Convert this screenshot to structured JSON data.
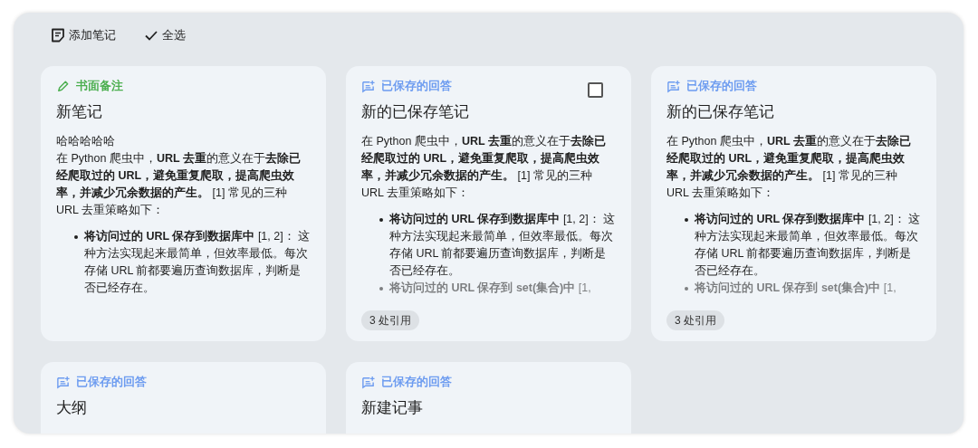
{
  "toolbar": [
    {
      "kind": "add",
      "label": "添加笔记"
    },
    {
      "kind": "select_all",
      "label": "全选"
    }
  ],
  "notes": [
    {
      "source": {
        "kind": "written",
        "label": "书面备注"
      },
      "title": "新笔记",
      "lines": [
        "哈哈哈哈哈",
        "在 Python 爬虫中，**URL 去重**的意义在于**去除已经爬取过的 URL，避免重复爬取，提高爬虫效率，并减少冗余数据的产生。** [1] 常见的三种 URL 去重策略如下："
      ],
      "bullets": [
        "**将访问过的 URL 保存到数据库中** [1, 2]： 这种方法实现起来最简单，但效率最低。每次存储 URL 前都要遍历查询数据库，判断是否已经存在。"
      ]
    },
    {
      "source": {
        "kind": "saved",
        "label": "已保存的回答"
      },
      "title": "新的已保存笔记",
      "checkbox": {
        "checked": false
      },
      "lines": [
        "在 Python 爬虫中，**URL 去重**的意义在于**去除已经爬取过的 URL，避免重复爬取，提高爬虫效率，并减少冗余数据的产生。** [1] 常见的三种 URL 去重策略如下："
      ],
      "bullets": [
        "**将访问过的 URL 保存到数据库中** [1, 2]： 这种方法实现起来最简单，但效率最低。每次存储 URL 前都要遍历查询数据库，判断是否已经存在。",
        "**将访问过的 URL 保存到 set(集合)中** [1,"
      ],
      "citations": "3 处引用"
    },
    {
      "source": {
        "kind": "saved",
        "label": "已保存的回答"
      },
      "title": "新的已保存笔记",
      "lines": [
        "在 Python 爬虫中，**URL 去重**的意义在于**去除已经爬取过的 URL，避免重复爬取，提高爬虫效率，并减少冗余数据的产生。** [1] 常见的三种 URL 去重策略如下："
      ],
      "bullets": [
        "**将访问过的 URL 保存到数据库中** [1, 2]： 这种方法实现起来最简单，但效率最低。每次存储 URL 前都要遍历查询数据库，判断是否已经存在。",
        "**将访问过的 URL 保存到 set(集合)中** [1,"
      ],
      "citations": "3 处引用"
    },
    {
      "source": {
        "kind": "saved",
        "label": "已保存的回答"
      },
      "title": "大纲"
    },
    {
      "source": {
        "kind": "saved",
        "label": "已保存的回答"
      },
      "title": "新建记事"
    }
  ]
}
